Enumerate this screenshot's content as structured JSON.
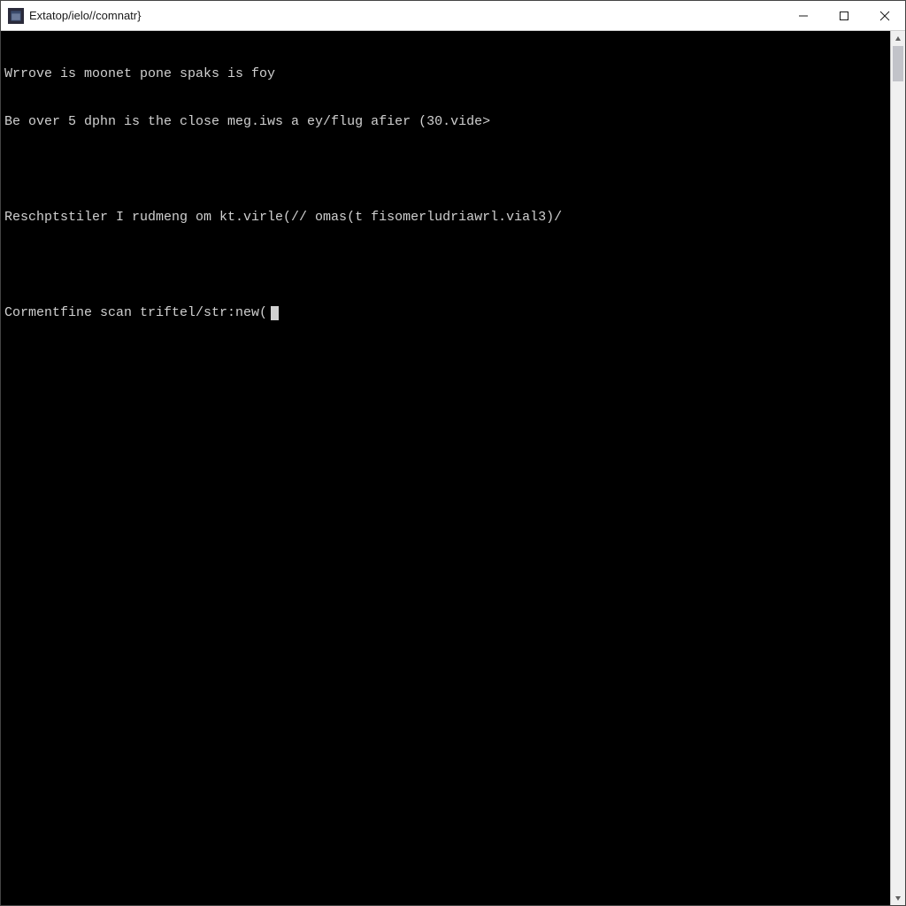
{
  "window": {
    "title": "Extatop/ielo//comnatr}"
  },
  "terminal": {
    "lines": [
      "Wrrove is moonet pone spaks is foy",
      "Be over 5 dphn is the close meg.iws a ey/flug afier (30.vide>",
      "",
      "Reschptstiler I rudmeng om kt.virle(// omas(t fisomerludriawrl.vial3)/",
      ""
    ],
    "prompt": "Cormentfine scan triftel/str:new("
  }
}
